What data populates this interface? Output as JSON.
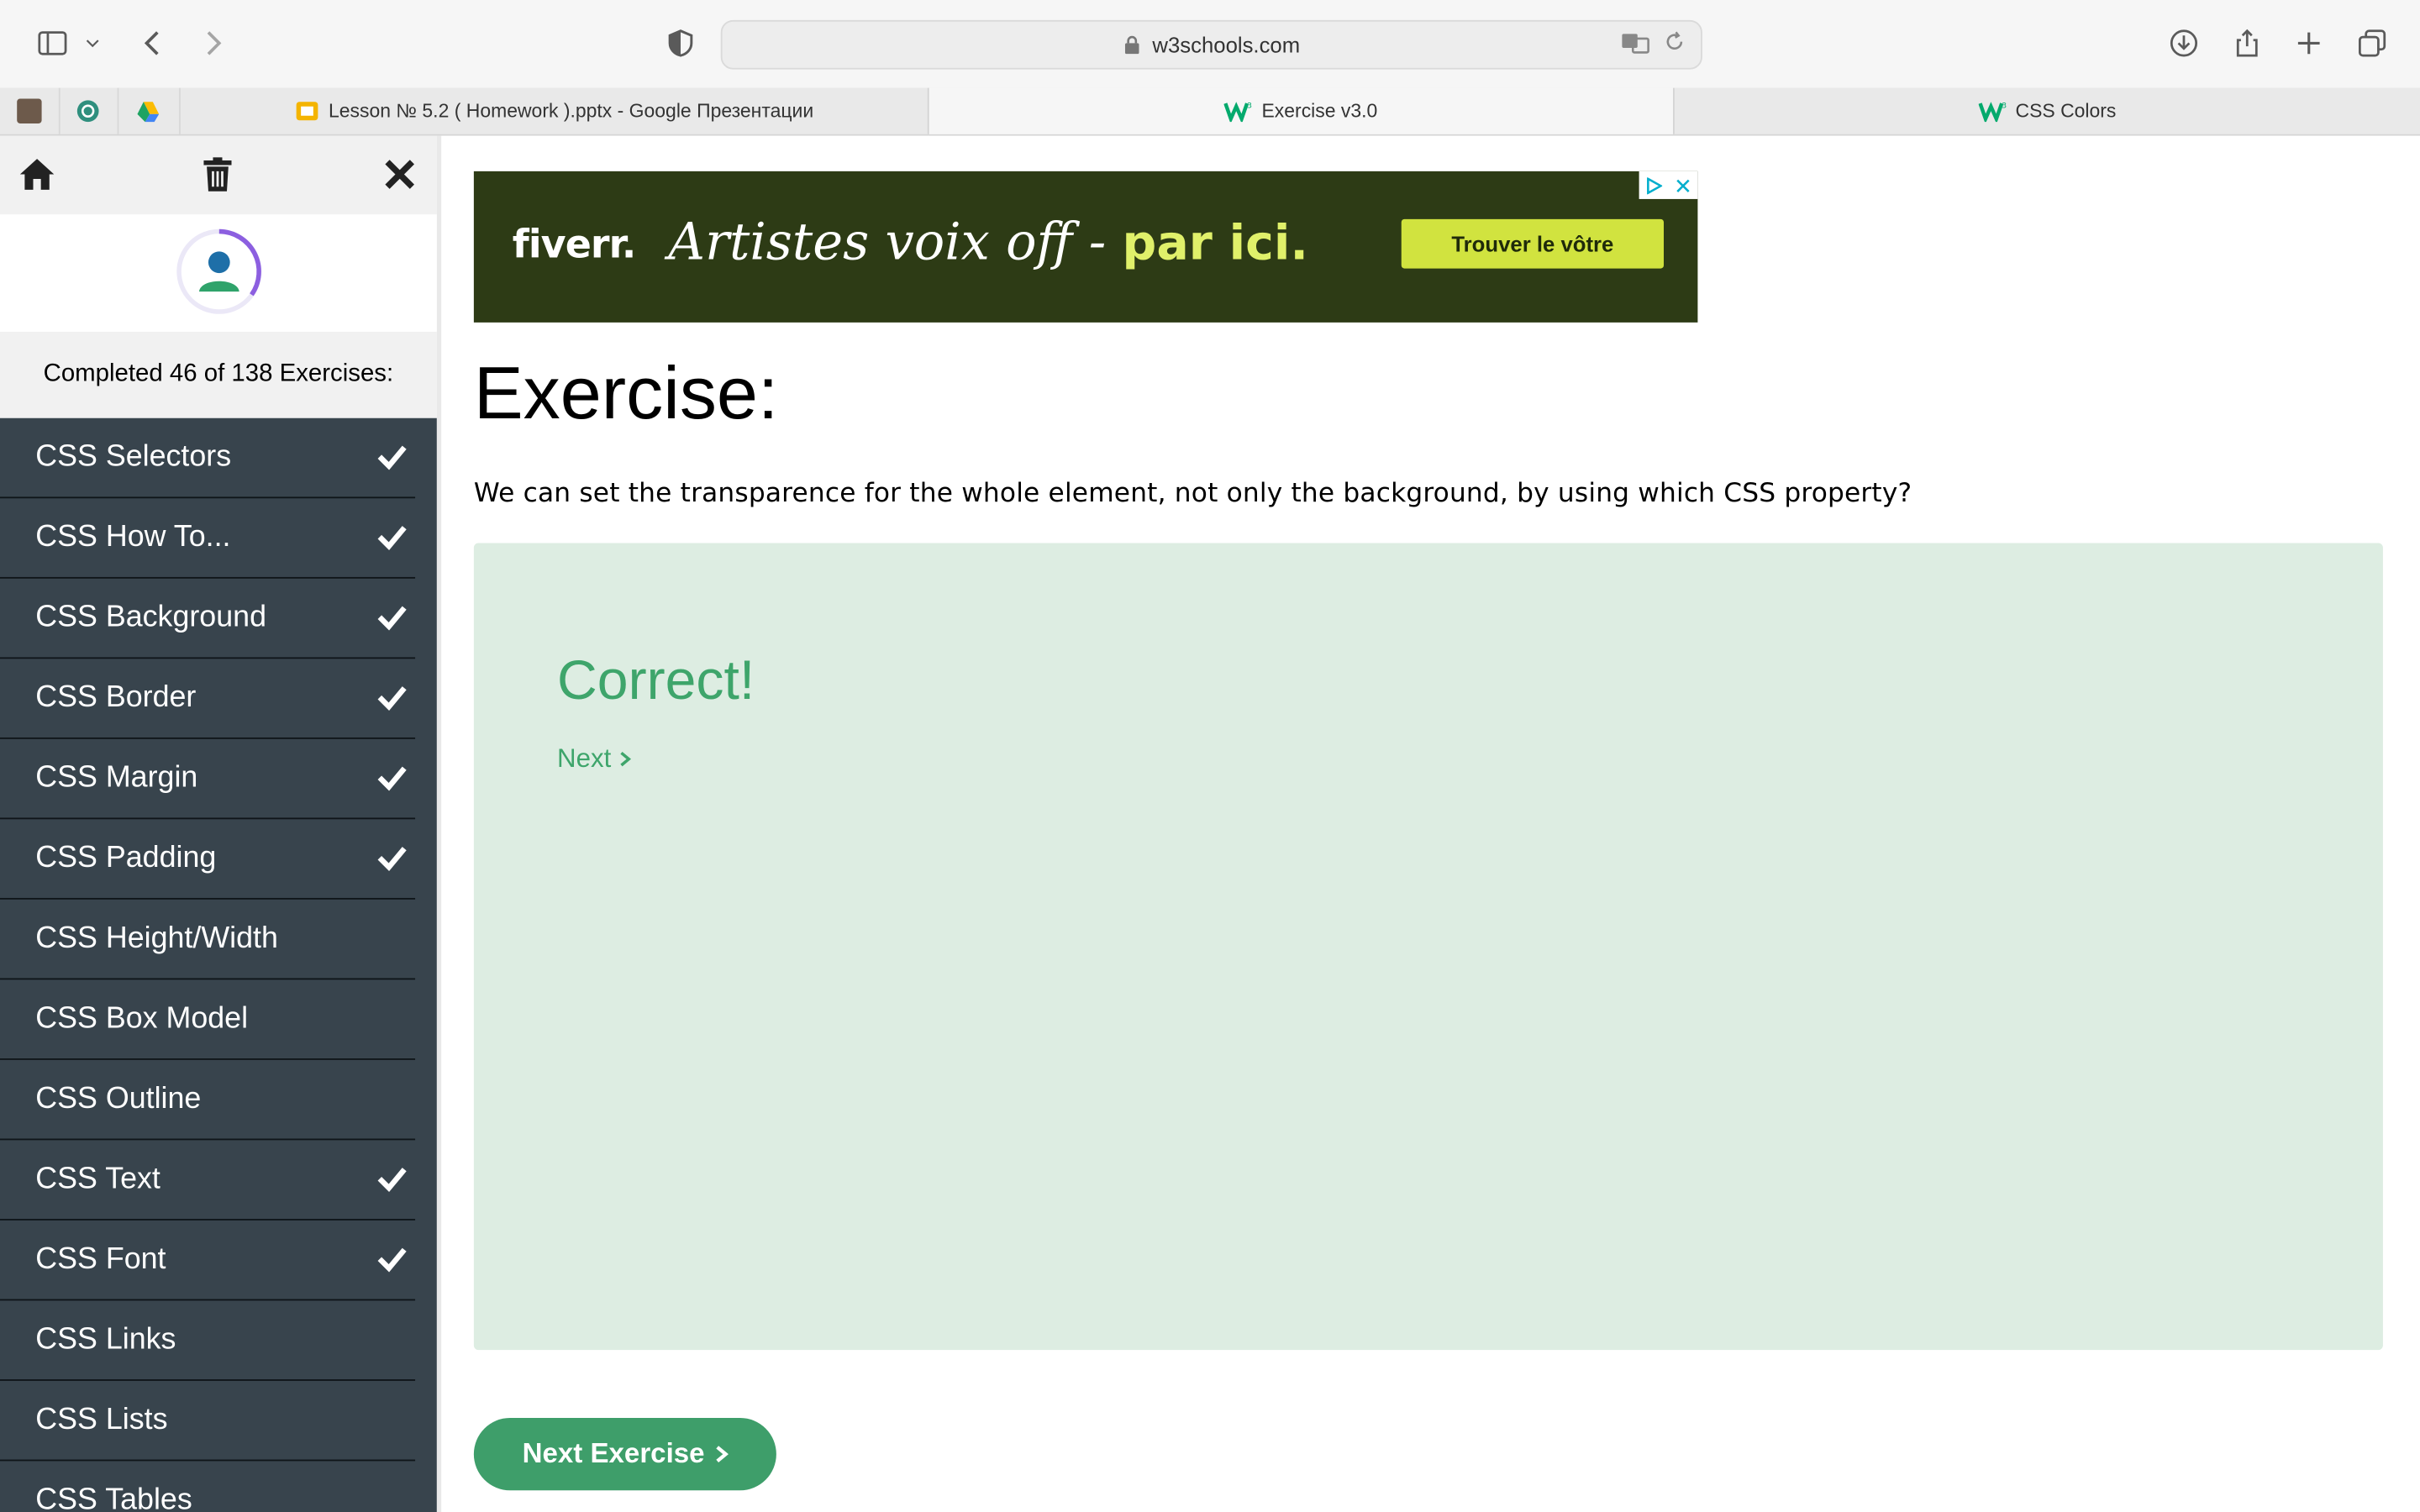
{
  "browser": {
    "url": "w3schools.com",
    "tabs": [
      {
        "label": "Lesson № 5.2 ( Homework ).pptx - Google Презентации",
        "active": false,
        "favicon": "slides-icon"
      },
      {
        "label": "Exercise v3.0",
        "active": true,
        "favicon": "w3schools-icon"
      },
      {
        "label": "CSS Colors",
        "active": false,
        "favicon": "w3schools-icon"
      }
    ]
  },
  "sidebar": {
    "progress_text": "Completed 46 of 138 Exercises:",
    "items": [
      {
        "label": "CSS Selectors",
        "done": true
      },
      {
        "label": "CSS How To...",
        "done": true
      },
      {
        "label": "CSS Background",
        "done": true
      },
      {
        "label": "CSS Border",
        "done": true
      },
      {
        "label": "CSS Margin",
        "done": true
      },
      {
        "label": "CSS Padding",
        "done": true
      },
      {
        "label": "CSS Height/Width",
        "done": false
      },
      {
        "label": "CSS Box Model",
        "done": false
      },
      {
        "label": "CSS Outline",
        "done": false
      },
      {
        "label": "CSS Text",
        "done": true
      },
      {
        "label": "CSS Font",
        "done": true
      },
      {
        "label": "CSS Links",
        "done": false
      },
      {
        "label": "CSS Lists",
        "done": false
      },
      {
        "label": "CSS Tables",
        "done": false
      }
    ]
  },
  "ad": {
    "logo": "fiverr.",
    "slogan": "Artistes voix off -",
    "slogan_accent": "par ici.",
    "button": "Trouver le vôtre"
  },
  "main": {
    "title": "Exercise:",
    "question": "We can set the transparence for the whole element, not only the background, by using which CSS property?",
    "result": "Correct!",
    "next_link": "Next",
    "next_button": "Next Exercise"
  },
  "colors": {
    "sidebar_bg": "#38444d",
    "success_green": "#3ea56b",
    "answer_bg": "#ddede2"
  }
}
